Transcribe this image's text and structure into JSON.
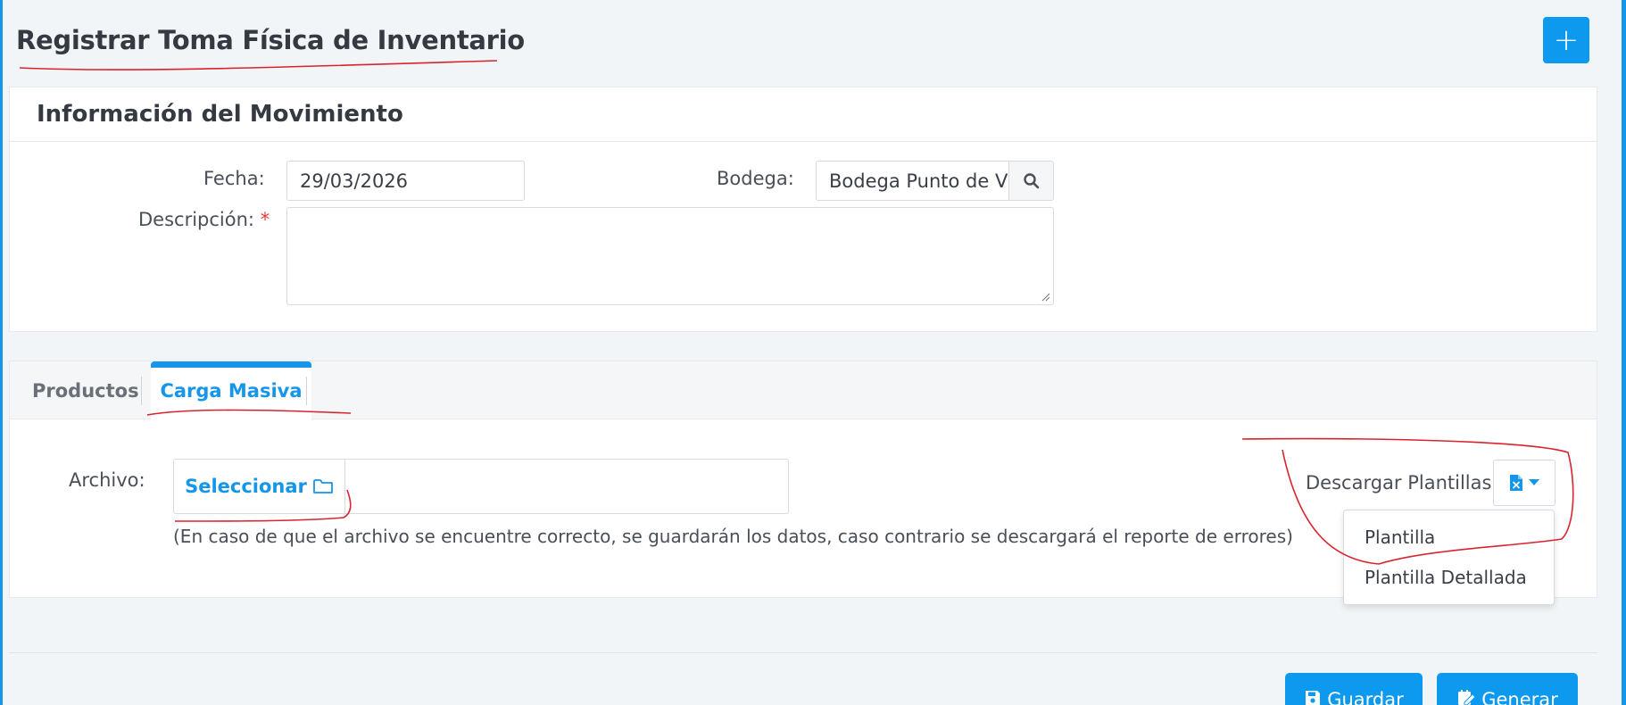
{
  "page": {
    "title": "Registrar Toma Física de Inventario",
    "add_button": "+"
  },
  "movement": {
    "section_title": "Información del Movimiento",
    "fecha_label": "Fecha:",
    "fecha_value": "29/03/2026",
    "bodega_label": "Bodega:",
    "bodega_value": "Bodega Punto de V",
    "descripcion_label": "Descripción:",
    "required_mark": "*",
    "descripcion_value": ""
  },
  "tabs": [
    {
      "label": "Productos",
      "active": false
    },
    {
      "label": "Carga Masiva",
      "active": true
    }
  ],
  "bulk": {
    "archivo_label": "Archivo:",
    "select_button": "Seleccionar",
    "file_name": "",
    "hint": "(En caso de que el archivo se encuentre correcto, se guardarán los datos, caso contrario se descargará el reporte de errores)",
    "download_label": "Descargar Plantillas",
    "download_options": [
      "Plantilla",
      "Plantilla Detallada"
    ]
  },
  "footer": {
    "guardar": "Guardar",
    "generar": "Generar"
  },
  "colors": {
    "accent": "#1596e8",
    "button": "#0d99ee",
    "annotation": "#d9232e",
    "required": "#e53935"
  },
  "icons": [
    "plus-icon",
    "search-icon",
    "folder-icon",
    "file-excel-icon",
    "caret-down-icon",
    "save-icon",
    "calendar-edit-icon"
  ]
}
